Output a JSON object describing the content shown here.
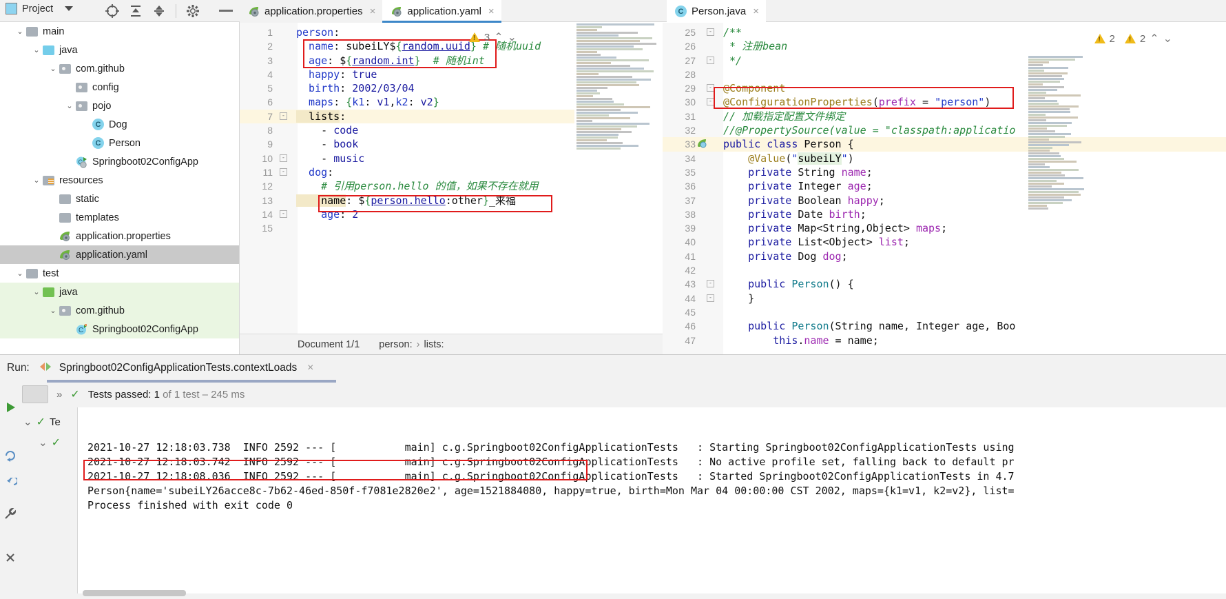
{
  "toolbar": {
    "project_label": "Project",
    "icons": [
      "target-icon",
      "expand-all-icon",
      "collapse-all-icon",
      "gear-icon",
      "minimize-icon"
    ]
  },
  "tabs": [
    {
      "label": "application.properties",
      "icon": "spring-leaf-icon",
      "active": false,
      "close": "×"
    },
    {
      "label": "application.yaml",
      "icon": "spring-leaf-icon",
      "active": true,
      "close": "×"
    },
    {
      "label": "Person.java",
      "icon": "java-class-icon",
      "active": false,
      "close": "×"
    }
  ],
  "tree": [
    {
      "label": "main",
      "indent": 1,
      "chevron": "v",
      "icon": "folder-gray",
      "state": ""
    },
    {
      "label": "java",
      "indent": 2,
      "chevron": "v",
      "icon": "folder-blue",
      "state": ""
    },
    {
      "label": "com.github",
      "indent": 3,
      "chevron": "v",
      "icon": "folder-pkg",
      "state": ""
    },
    {
      "label": "config",
      "indent": 4,
      "chevron": "",
      "icon": "folder-pkg",
      "state": ""
    },
    {
      "label": "pojo",
      "indent": 4,
      "chevron": "v",
      "icon": "folder-pkg",
      "state": ""
    },
    {
      "label": "Dog",
      "indent": 5,
      "chevron": "",
      "icon": "java-class",
      "state": ""
    },
    {
      "label": "Person",
      "indent": 5,
      "chevron": "",
      "icon": "java-class",
      "state": ""
    },
    {
      "label": "Springboot02ConfigApp",
      "indent": 4,
      "chevron": "",
      "icon": "spring-run",
      "state": ""
    },
    {
      "label": "resources",
      "indent": 2,
      "chevron": "v",
      "icon": "folder-res",
      "state": ""
    },
    {
      "label": "static",
      "indent": 3,
      "chevron": "",
      "icon": "folder-gray",
      "state": ""
    },
    {
      "label": "templates",
      "indent": 3,
      "chevron": "",
      "icon": "folder-gray",
      "state": ""
    },
    {
      "label": "application.properties",
      "indent": 3,
      "chevron": "",
      "icon": "spring-leaf",
      "state": ""
    },
    {
      "label": "application.yaml",
      "indent": 3,
      "chevron": "",
      "icon": "spring-leaf",
      "state": "selected"
    },
    {
      "label": "test",
      "indent": 1,
      "chevron": "v",
      "icon": "folder-gray",
      "state": ""
    },
    {
      "label": "java",
      "indent": 2,
      "chevron": "v",
      "icon": "folder-green",
      "state": "green"
    },
    {
      "label": "com.github",
      "indent": 3,
      "chevron": "v",
      "icon": "folder-pkg",
      "state": "green"
    },
    {
      "label": "Springboot02ConfigApp",
      "indent": 4,
      "chevron": "",
      "icon": "java-test",
      "state": "green"
    }
  ],
  "yaml_editor": {
    "warning_count": "3",
    "up_arrow": "⌃",
    "down_arrow": "⌄",
    "lines": [
      {
        "n": "1",
        "segs": [
          [
            "kw",
            "person"
          ],
          [
            "plain",
            ":"
          ]
        ]
      },
      {
        "n": "2",
        "segs": [
          [
            "kw",
            "  name"
          ],
          [
            "plain",
            ": "
          ],
          [
            "plain",
            "subeiLY$"
          ],
          [
            "brace",
            "{"
          ],
          [
            "link",
            "random.uuid"
          ],
          [
            "brace",
            "}"
          ],
          [
            "plain",
            " "
          ],
          [
            "cmt",
            "# 随机uuid"
          ]
        ]
      },
      {
        "n": "3",
        "segs": [
          [
            "kw",
            "  age"
          ],
          [
            "plain",
            ": "
          ],
          [
            "plain",
            "$"
          ],
          [
            "brace",
            "{"
          ],
          [
            "link",
            "random.int"
          ],
          [
            "brace",
            "}"
          ],
          [
            "plain",
            "  "
          ],
          [
            "cmt",
            "# 随机int"
          ]
        ]
      },
      {
        "n": "4",
        "segs": [
          [
            "kw",
            "  happy"
          ],
          [
            "plain",
            ": "
          ],
          [
            "kwv",
            "true"
          ]
        ]
      },
      {
        "n": "5",
        "segs": [
          [
            "kw",
            "  birth"
          ],
          [
            "plain",
            ": "
          ],
          [
            "kwv",
            "2002/03/04"
          ]
        ]
      },
      {
        "n": "6",
        "segs": [
          [
            "kw",
            "  maps"
          ],
          [
            "plain",
            ": "
          ],
          [
            "brace",
            "{"
          ],
          [
            "kw",
            "k1"
          ],
          [
            "plain",
            ": "
          ],
          [
            "kwv",
            "v1"
          ],
          [
            "plain",
            ","
          ],
          [
            "kw",
            "k2"
          ],
          [
            "plain",
            ": "
          ],
          [
            "kwv",
            "v2"
          ],
          [
            "brace",
            "}"
          ]
        ]
      },
      {
        "n": "7",
        "segs": [
          [
            "sel",
            "  lists"
          ],
          [
            "plain",
            ":"
          ]
        ],
        "highlight": true,
        "fold": "-"
      },
      {
        "n": "8",
        "segs": [
          [
            "plain",
            "    - "
          ],
          [
            "kwv",
            "code"
          ]
        ]
      },
      {
        "n": "9",
        "segs": [
          [
            "plain",
            "    - "
          ],
          [
            "kwv",
            "book"
          ]
        ]
      },
      {
        "n": "10",
        "segs": [
          [
            "plain",
            "    - "
          ],
          [
            "kwv",
            "music"
          ]
        ],
        "fold": "-"
      },
      {
        "n": "11",
        "segs": [
          [
            "kw",
            "  dog"
          ],
          [
            "plain",
            ":"
          ]
        ],
        "fold": "-"
      },
      {
        "n": "12",
        "segs": [
          [
            "cmt",
            "    # 引用person.hello 的值，如果不存在就用"
          ]
        ]
      },
      {
        "n": "13",
        "segs": [
          [
            "sel",
            "    name"
          ],
          [
            "plain",
            ": "
          ],
          [
            "plain",
            "$"
          ],
          [
            "brace",
            "{"
          ],
          [
            "link",
            "person.hello"
          ],
          [
            "plain",
            ":other"
          ],
          [
            "brace",
            "}"
          ],
          [
            "plain",
            "_来福"
          ]
        ]
      },
      {
        "n": "14",
        "segs": [
          [
            "kw",
            "    age"
          ],
          [
            "plain",
            ": "
          ],
          [
            "kwv",
            "2"
          ]
        ],
        "fold": "-"
      },
      {
        "n": "15",
        "segs": [
          [
            "plain",
            ""
          ]
        ]
      }
    ],
    "breadcrumb": {
      "document": "Document 1/1",
      "path": [
        "person:",
        "lists:"
      ],
      "separator": "›"
    }
  },
  "java_editor": {
    "warnings": [
      {
        "icon": "warning-triangle",
        "count": "2"
      },
      {
        "icon": "warning-triangle",
        "count": "2"
      }
    ],
    "up_arrow": "⌃",
    "down_arrow": "⌄",
    "lines": [
      {
        "n": "25",
        "segs": [
          [
            "jdoc",
            "/**"
          ]
        ],
        "fold": "-"
      },
      {
        "n": "26",
        "segs": [
          [
            "jdoc",
            " * 注册bean"
          ]
        ]
      },
      {
        "n": "27",
        "segs": [
          [
            "jdoc",
            " */"
          ]
        ],
        "fold": "-"
      },
      {
        "n": "28",
        "segs": [
          [
            "plain",
            ""
          ]
        ]
      },
      {
        "n": "29",
        "segs": [
          [
            "jann",
            "@Component"
          ]
        ],
        "fold": "-"
      },
      {
        "n": "30",
        "segs": [
          [
            "jann",
            "@ConfigurationProperties"
          ],
          [
            "plain",
            "("
          ],
          [
            "jfield",
            "prefix"
          ],
          [
            "plain",
            " = "
          ],
          [
            "jstr",
            "\"person\""
          ],
          [
            "plain",
            ")"
          ]
        ],
        "fold": "-"
      },
      {
        "n": "31",
        "segs": [
          [
            "jcmt",
            "// 加载指定配置文件绑定"
          ]
        ]
      },
      {
        "n": "32",
        "segs": [
          [
            "jcmt",
            "//@PropertySource(value = \"classpath:applicatio"
          ]
        ]
      },
      {
        "n": "33",
        "segs": [
          [
            "jkw",
            "public class "
          ],
          [
            "jtype",
            "Person"
          ],
          [
            "plain",
            " {"
          ]
        ],
        "highlight": true,
        "gutter_icon": "spring-bean-icon"
      },
      {
        "n": "34",
        "segs": [
          [
            "plain",
            "    "
          ],
          [
            "jann",
            "@Value"
          ],
          [
            "plain",
            "("
          ],
          [
            "jstr",
            "\""
          ],
          [
            "greenhl",
            "subeiLY"
          ],
          [
            "jstr",
            "\""
          ],
          [
            "plain",
            ")"
          ]
        ]
      },
      {
        "n": "35",
        "segs": [
          [
            "plain",
            "    "
          ],
          [
            "jkw",
            "private "
          ],
          [
            "jtype",
            "String "
          ],
          [
            "jfield",
            "name"
          ],
          [
            "plain",
            ";"
          ]
        ]
      },
      {
        "n": "36",
        "segs": [
          [
            "plain",
            "    "
          ],
          [
            "jkw",
            "private "
          ],
          [
            "jtype",
            "Integer "
          ],
          [
            "jfield",
            "age"
          ],
          [
            "plain",
            ";"
          ]
        ]
      },
      {
        "n": "37",
        "segs": [
          [
            "plain",
            "    "
          ],
          [
            "jkw",
            "private "
          ],
          [
            "jtype",
            "Boolean "
          ],
          [
            "jfield",
            "happy"
          ],
          [
            "plain",
            ";"
          ]
        ]
      },
      {
        "n": "38",
        "segs": [
          [
            "plain",
            "    "
          ],
          [
            "jkw",
            "private "
          ],
          [
            "jtype",
            "Date "
          ],
          [
            "jfield",
            "birth"
          ],
          [
            "plain",
            ";"
          ]
        ]
      },
      {
        "n": "39",
        "segs": [
          [
            "plain",
            "    "
          ],
          [
            "jkw",
            "private "
          ],
          [
            "jtype",
            "Map<String,Object> "
          ],
          [
            "jfield",
            "maps"
          ],
          [
            "plain",
            ";"
          ]
        ]
      },
      {
        "n": "40",
        "segs": [
          [
            "plain",
            "    "
          ],
          [
            "jkw",
            "private "
          ],
          [
            "jtype",
            "List<Object> "
          ],
          [
            "jfield",
            "list"
          ],
          [
            "plain",
            ";"
          ]
        ]
      },
      {
        "n": "41",
        "segs": [
          [
            "plain",
            "    "
          ],
          [
            "jkw",
            "private "
          ],
          [
            "jtype",
            "Dog "
          ],
          [
            "jfield",
            "dog"
          ],
          [
            "plain",
            ";"
          ]
        ]
      },
      {
        "n": "42",
        "segs": [
          [
            "plain",
            ""
          ]
        ]
      },
      {
        "n": "43",
        "segs": [
          [
            "plain",
            "    "
          ],
          [
            "jkw",
            "public "
          ],
          [
            "jcls",
            "Person"
          ],
          [
            "plain",
            "() {"
          ]
        ],
        "fold": "-"
      },
      {
        "n": "44",
        "segs": [
          [
            "plain",
            "    }"
          ]
        ],
        "fold": "-"
      },
      {
        "n": "45",
        "segs": [
          [
            "plain",
            ""
          ]
        ]
      },
      {
        "n": "46",
        "segs": [
          [
            "plain",
            "    "
          ],
          [
            "jkw",
            "public "
          ],
          [
            "jcls",
            "Person"
          ],
          [
            "plain",
            "(String name, Integer age, Boo"
          ]
        ]
      },
      {
        "n": "47",
        "segs": [
          [
            "plain",
            "        "
          ],
          [
            "jkw",
            "this"
          ],
          [
            "plain",
            "."
          ],
          [
            "jfield",
            "name"
          ],
          [
            "plain",
            " = name;"
          ]
        ]
      }
    ]
  },
  "run_panel": {
    "run_label": "Run:",
    "configuration": "Springboot02ConfigApplicationTests.contextLoads",
    "close_tab": "×",
    "tests_passed_prefix": "Tests passed: 1",
    "tests_passed_suffix": " of 1 test – 245 ms",
    "test_tree_label": "Te",
    "chevron": "»",
    "console_lines": [
      "2021-10-27 12:18:03.738  INFO 2592 --- [           main] c.g.Springboot02ConfigApplicationTests   : Starting Springboot02ConfigApplicationTests using",
      "2021-10-27 12:18:03.742  INFO 2592 --- [           main] c.g.Springboot02ConfigApplicationTests   : No active profile set, falling back to default pr",
      "2021-10-27 12:18:08.036  INFO 2592 --- [           main] c.g.Springboot02ConfigApplicationTests   : Started Springboot02ConfigApplicationTests in 4.7",
      "Person{name='subeiLY26acce8c-7b62-46ed-850f-f7081e2820e2', age=1521884080, happy=true, birth=Mon Mar 04 00:00:00 CST 2002, maps={k1=v1, k2=v2}, list=",
      "",
      "Process finished with exit code 0"
    ],
    "left_icons": [
      "run-icon",
      "rerun-failed-icon",
      "restart-icon",
      "settings-wrench-icon",
      "close-panel-icon"
    ]
  },
  "colors": {
    "accent": "#3c87c8",
    "highlight_box": "#e01b1b",
    "warning": "#f0bb1a",
    "success": "#3d9a35",
    "keyword": "#1a1aa0",
    "comment": "#2a8a3e",
    "annotation": "#9a7d1a"
  }
}
